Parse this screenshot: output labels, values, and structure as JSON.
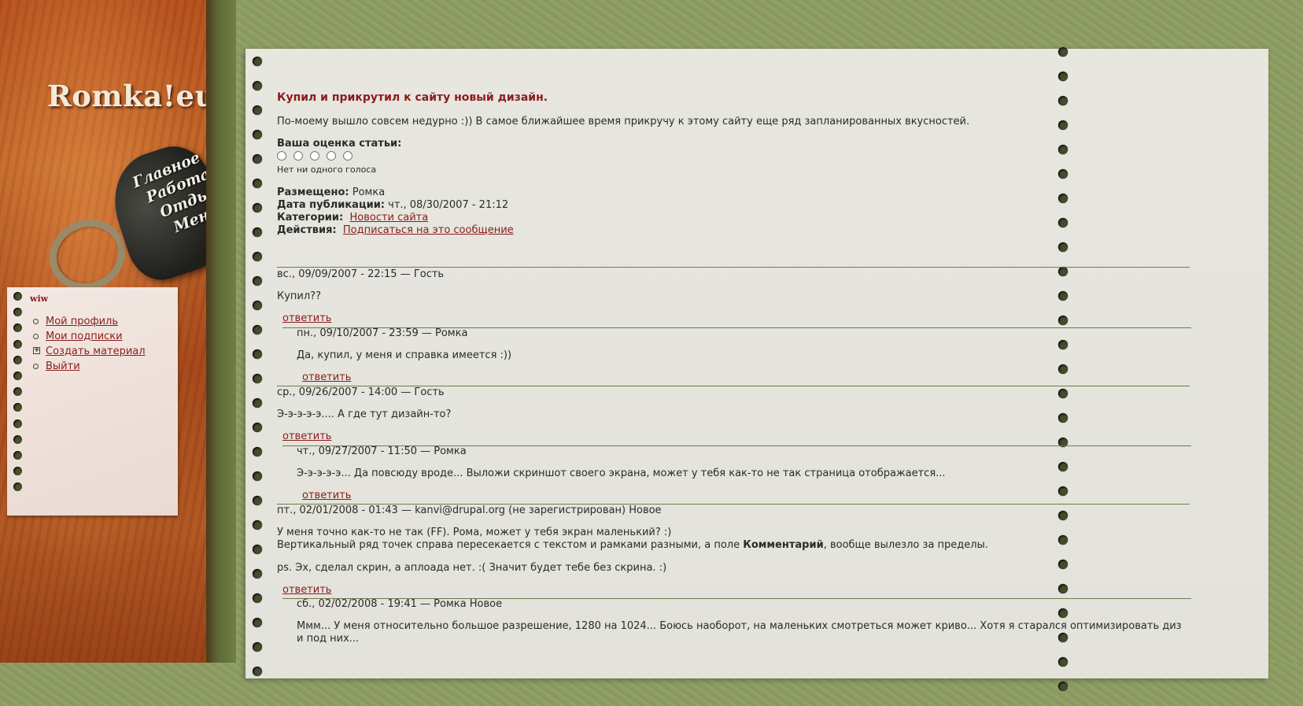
{
  "site": {
    "logo": "Romka!eu",
    "main_nav": [
      "Главное",
      "Работа",
      "Отдых",
      "Меню"
    ]
  },
  "user_block": {
    "title": "wiw",
    "items": [
      {
        "label": "Мой профиль"
      },
      {
        "label": "Мои подписки"
      },
      {
        "label": "Создать материал"
      },
      {
        "label": "Выйти"
      }
    ]
  },
  "article": {
    "title": "Купил и прикрутил к сайту новый дизайн.",
    "body": "По-моему вышло совсем недурно :)) В самое ближайшее время прикручу к этому сайту еще ряд запланированных вкусностей.",
    "rating_label": "Ваша оценка статьи:",
    "votes_text": "Нет ни одного голоса",
    "posted_by_label": "Размещено:",
    "posted_by": "Ромка",
    "date_label": "Дата публикации:",
    "date": "чт., 08/30/2007 - 21:12",
    "categories_label": "Категории:",
    "category": "Новости сайта",
    "actions_label": "Действия:",
    "action": "Подписаться на это сообщение"
  },
  "comments": [
    {
      "head": "вс., 09/09/2007 - 22:15 — Гость",
      "body": "Купил??",
      "reply": "ответить"
    },
    {
      "head": "пн., 09/10/2007 - 23:59 — Ромка",
      "body": "Да, купил, у меня и справка имеется :))",
      "reply": "ответить"
    },
    {
      "head": "ср., 09/26/2007 - 14:00 — Гость",
      "body": "Э-э-э-э-э.... А где тут дизайн-то?",
      "reply": "ответить"
    },
    {
      "head": "чт., 09/27/2007 - 11:50 — Ромка",
      "body": "Э-э-э-э-э... Да повсюду вроде... Выложи скриншот своего экрана, может у тебя как-то не так страница отображается...",
      "reply": "ответить"
    },
    {
      "head": "пт., 02/01/2008 - 01:43 — kanvi@drupal.org (не зарегистрирован) Новое",
      "body_line1": "У меня точно как-то не так (FF). Рома, может у тебя экран маленький? :)",
      "body_line2_pre": "Вертикальный ряд точек справа пересекается с текстом и рамками разными, а поле ",
      "body_line2_bold": "Комментарий",
      "body_line2_post": ", вообще вылезло за пределы.",
      "body_line3": "ps. Эх, сделал скрин, а аплоада нет. :( Значит будет тебе без скрина. :)",
      "reply": "ответить"
    },
    {
      "head": "сб., 02/02/2008 - 19:41 — Ромка Новое",
      "body": "Ммм... У меня относительно большое разрешение, 1280 на 1024... Боюсь наоборот, на маленьких смотреться может криво... Хотя я старался оптимизировать диз и под них..."
    }
  ]
}
